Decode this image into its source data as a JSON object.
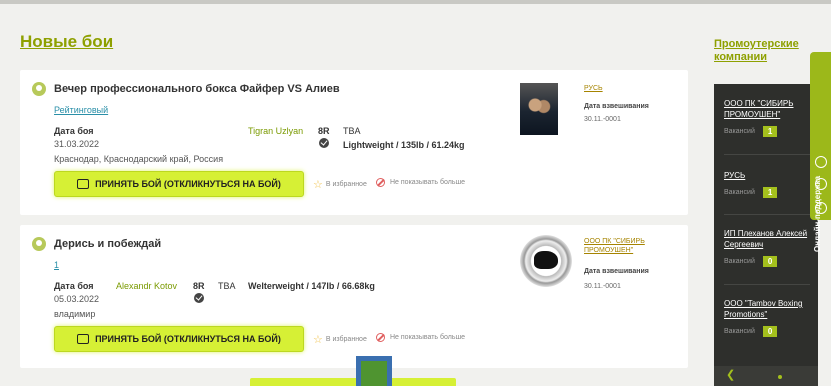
{
  "page": {
    "title": "Новые бои"
  },
  "fights": [
    {
      "title": "Вечер профессионального бокса Файфер VS Алиев",
      "tag": "Рейтинговый",
      "date_label": "Дата боя",
      "date": "31.03.2022",
      "location": "Краснодар, Краснодарский край, Россия",
      "opponent": "Tigran Uzlyan",
      "rounds": "8R",
      "tba": "TBA",
      "weight": "Lightweight / 135lb / 61.24kg",
      "accept_label": "ПРИНЯТЬ БОЙ (ОТКЛИКНУТЬСЯ НА БОЙ)",
      "favorite_label": "В избранное",
      "hide_label": "Не показывать больше",
      "promoter": "РУСЬ",
      "weigh_label": "Дата взвешивания",
      "weigh_date": "30.11.-0001"
    },
    {
      "title": "Дерись и побеждай",
      "tag": "1",
      "date_label": "Дата боя",
      "date": "05.03.2022",
      "location": "владимир",
      "opponent": "Alexandr Kotov",
      "rounds": "8R",
      "tba": "TBA",
      "weight": "Welterweight / 147lb / 66.68kg",
      "accept_label": "ПРИНЯТЬ БОЙ (ОТКЛИКНУТЬСЯ НА БОЙ)",
      "favorite_label": "В избранное",
      "hide_label": "Не показывать больше",
      "promoter": "ООО ПК \"СИБИРЬ ПРОМОУШЕН\"",
      "weigh_label": "Дата взвешивания",
      "weigh_date": "30.11.-0001"
    }
  ],
  "sidebar": {
    "title": "Промоутерские компании",
    "vacancy_label": "Вакансий",
    "items": [
      {
        "name": "ООО ПК \"СИБИРЬ ПРОМОУШЕН\"",
        "count": "1"
      },
      {
        "name": "РУСЬ",
        "count": "1"
      },
      {
        "name": "ИП Плеханов Алексей Сергеевич",
        "count": "0"
      },
      {
        "name": "ООО \"Tambov Boxing Promotions\"",
        "count": "0"
      }
    ]
  },
  "online_tab": {
    "label": "Онлайн-поддержка"
  },
  "colors": {
    "accent": "#8ea000",
    "button": "#d6f035",
    "panel": "#2e2f2c"
  }
}
